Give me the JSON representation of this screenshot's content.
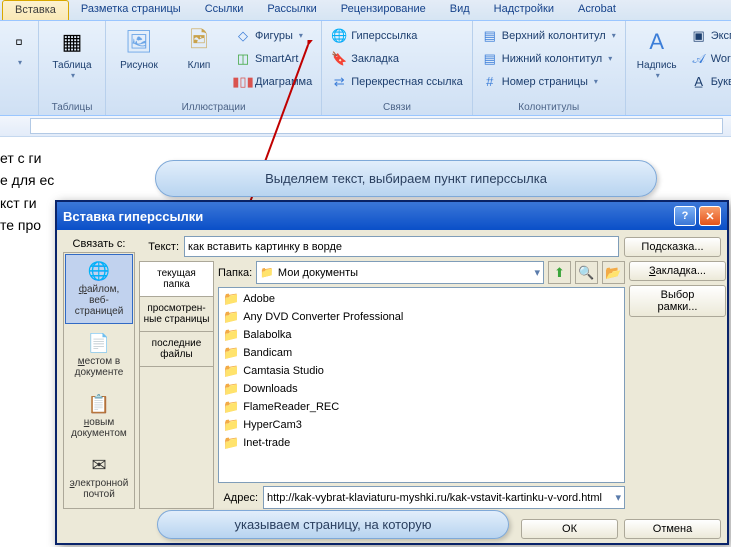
{
  "tabs": [
    "Вставка",
    "Разметка страницы",
    "Ссылки",
    "Рассылки",
    "Рецензирование",
    "Вид",
    "Надстройки",
    "Acrobat"
  ],
  "groups": {
    "tables": {
      "label": "Таблицы",
      "table": "Таблица"
    },
    "illus": {
      "label": "Иллюстрации",
      "pic": "Рисунок",
      "clip": "Клип",
      "shapes": "Фигуры",
      "smartart": "SmartArt",
      "chart": "Диаграмма"
    },
    "links": {
      "label": "Связи",
      "hyper": "Гиперссылка",
      "bookmark": "Закладка",
      "crossref": "Перекрестная ссылка"
    },
    "headfoot": {
      "label": "Колонтитулы",
      "header": "Верхний колонтитул",
      "footer": "Нижний колонтитул",
      "pagenum": "Номер страницы"
    },
    "text": {
      "label": "",
      "textbox": "Надпись",
      "express": "Экспр",
      "wordart": "Word",
      "dropcap": "Букви"
    }
  },
  "bubble1": "Выделяем текст, выбираем пункт гиперссылка",
  "bubble2": "указываем страницу, на которую",
  "dialog": {
    "title": "Вставка гиперссылки",
    "linkwith": "Связать с:",
    "text_label": "Текст:",
    "text_value": "как вставить картинку в ворде",
    "tooltip": "Подсказка...",
    "folder_label": "Папка:",
    "folder_value": "Мои документы",
    "addr_label": "Адрес:",
    "addr_value": "http://kak-vybrat-klaviaturu-myshki.ru/kak-vstavit-kartinku-v-vord.html",
    "link_opts": [
      "файлом, веб-страницей",
      "местом в документе",
      "новым документом",
      "электронной почтой"
    ],
    "browse_tabs": [
      "текущая папка",
      "просмотрен-ные страницы",
      "последние файлы"
    ],
    "files": [
      "Adobe",
      "Any DVD Converter Professional",
      "Balabolka",
      "Bandicam",
      "Camtasia Studio",
      "Downloads",
      "FlameReader_REC",
      "HyperCam3",
      "Inet-trade"
    ],
    "bookmark": "Закладка...",
    "frame": "Выбор рамки...",
    "ok": "ОК",
    "cancel": "Отмена"
  },
  "doctext": [
    "ет с ги",
    "е для ес",
    "кст ги",
    "те про"
  ]
}
